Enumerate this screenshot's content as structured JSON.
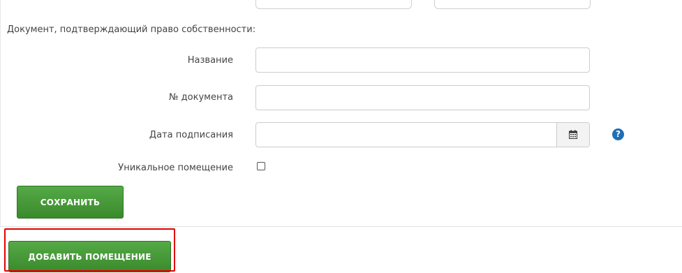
{
  "form": {
    "section_title": "Документ, подтверждающий право собственности:",
    "name_label": "Название",
    "name_value": "",
    "doc_number_label": "№ документа",
    "doc_number_value": "",
    "sign_date_label": "Дата подписания",
    "sign_date_value": "",
    "unique_room_label": "Уникальное помещение",
    "unique_room_checked": false
  },
  "icons": {
    "calendar": "calendar-icon",
    "help": "question-circle-icon",
    "help_glyph": "?"
  },
  "buttons": {
    "save_label": "СОХРАНИТЬ",
    "add_room_label": "ДОБАВИТЬ ПОМЕЩЕНИЕ"
  },
  "colors": {
    "button_green": "#4a9b3a",
    "help_blue": "#1f6fb5",
    "highlight_red": "#e00000"
  }
}
